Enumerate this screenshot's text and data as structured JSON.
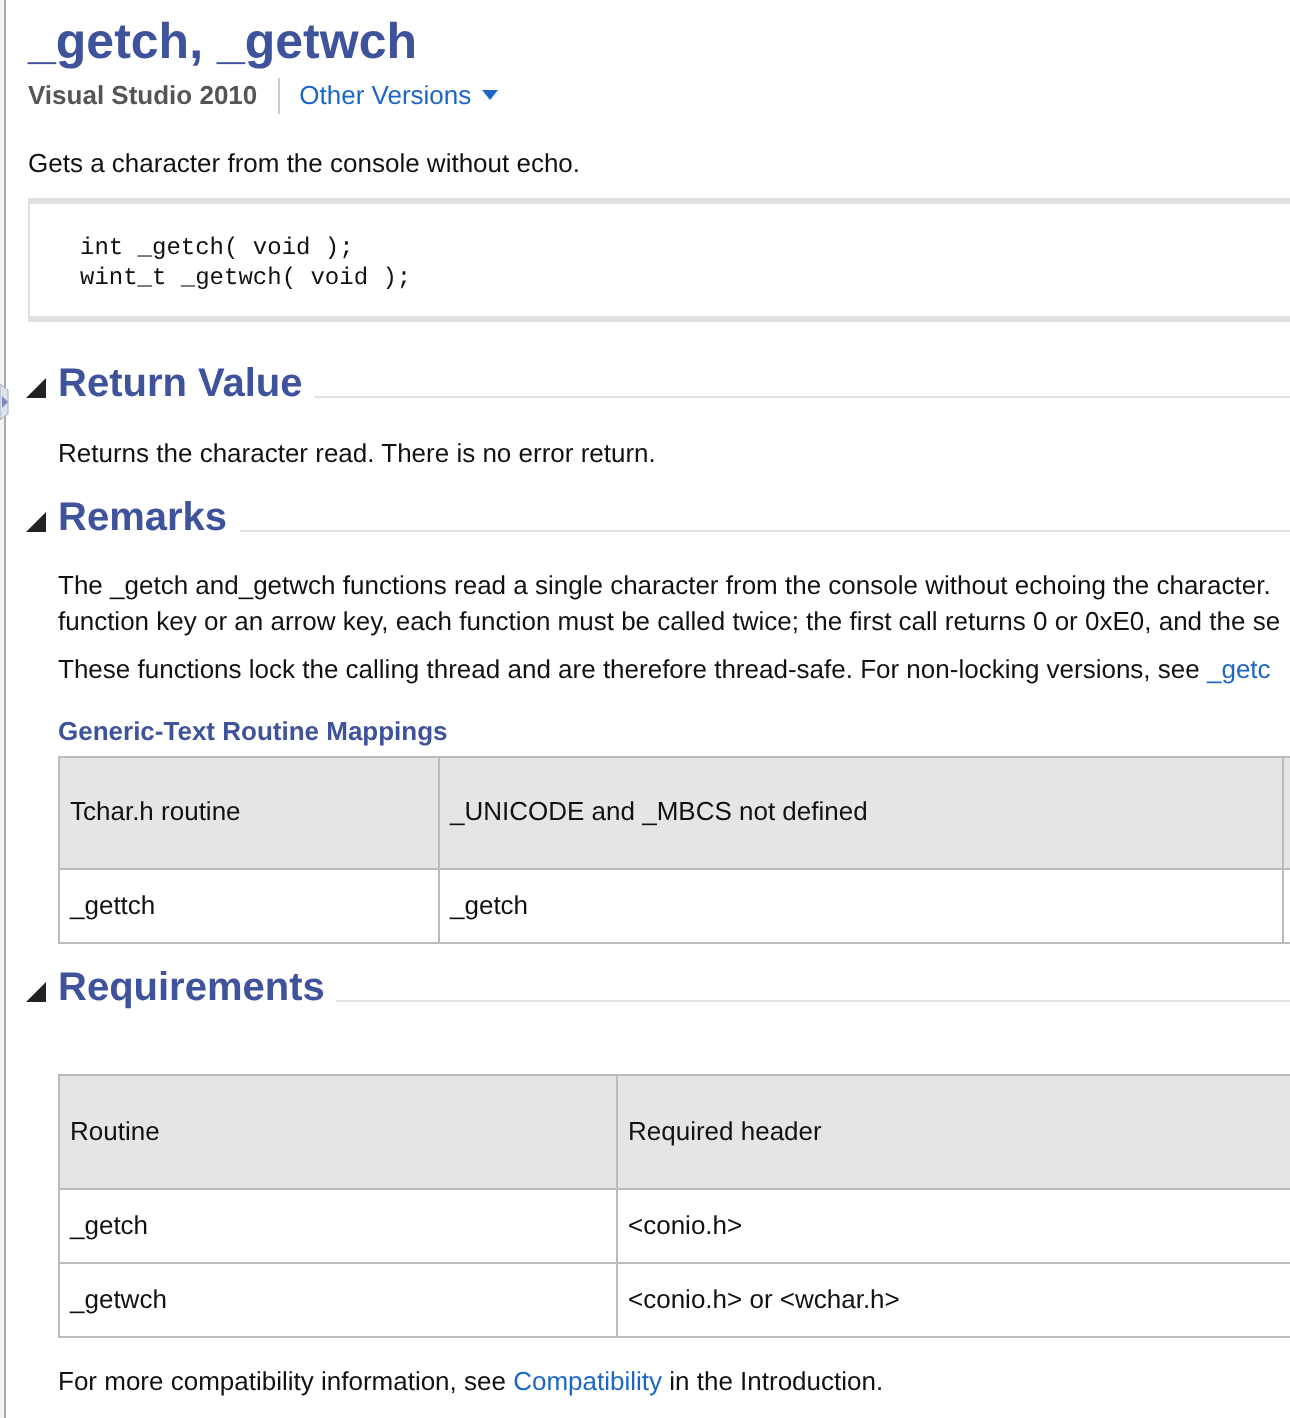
{
  "title": "_getch, _getwch",
  "version": "Visual Studio 2010",
  "other_versions": {
    "label": "Other Versions",
    "expanded": false
  },
  "summary": "Gets a character from the console without echo.",
  "code": [
    "int _getch( void );",
    "wint_t _getwch( void );"
  ],
  "sections": [
    {
      "kind": "text",
      "heading": "Return Value",
      "expanded": true,
      "lines": [
        "Returns the character read. There is no error return."
      ]
    },
    {
      "kind": "remarks",
      "heading": "Remarks",
      "expanded": true,
      "paragraph_lines": [
        "The _getch and_getwch functions read a single character from the console without echoing the character.",
        "function key or an arrow key, each function must be called twice; the first call returns 0 or 0xE0, and the se"
      ],
      "lock_text": "These functions lock the calling thread and are therefore thread-safe. For non-locking versions, see ",
      "lock_link": "_getc",
      "table_title": "Generic-Text Routine Mappings",
      "table": {
        "columns": [
          "Tchar.h routine",
          "_UNICODE and _MBCS not defined"
        ],
        "rows": [
          [
            "_gettch",
            "_getch"
          ]
        ]
      }
    },
    {
      "kind": "requirements",
      "heading": "Requirements",
      "expanded": true,
      "table": {
        "columns": [
          "Routine",
          "Required header"
        ],
        "rows": [
          [
            "_getch",
            "<conio.h>"
          ],
          [
            "_getwch",
            "<conio.h> or <wchar.h>"
          ]
        ]
      },
      "note_before": "For more compatibility information, see ",
      "note_link": "Compatibility",
      "note_after": " in the Introduction."
    }
  ]
}
